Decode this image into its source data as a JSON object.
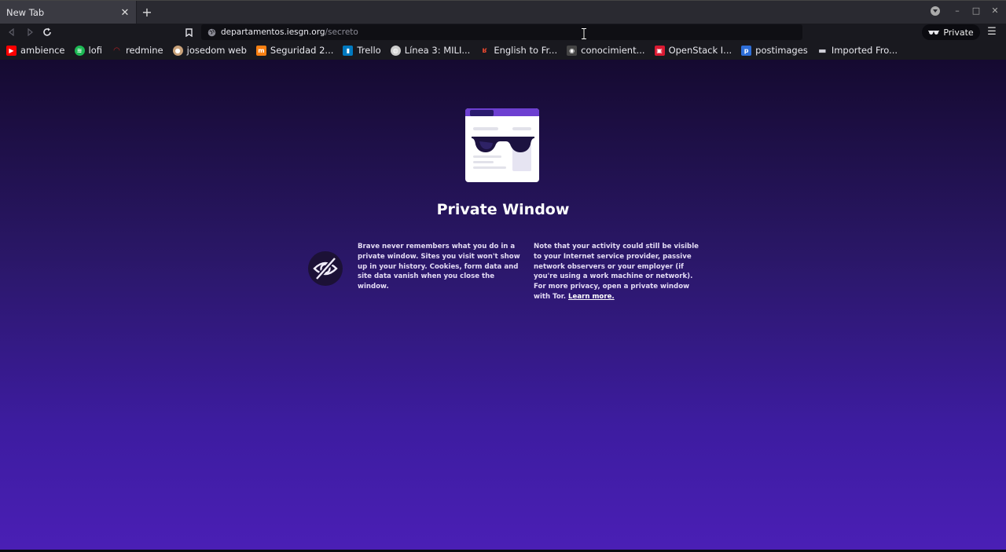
{
  "tab": {
    "title": "New Tab",
    "close_icon": "close-icon",
    "new_tab_label": "+"
  },
  "toolbar": {
    "url_host": "departamentos.iesgn.org",
    "url_path": "/secreto",
    "private_label": "Private"
  },
  "bookmarks": [
    {
      "label": "ambience",
      "icon": "youtube-icon",
      "color": "#ff0000"
    },
    {
      "label": "lofi",
      "icon": "spotify-icon",
      "color": "#1db954"
    },
    {
      "label": "redmine",
      "icon": "redmine-icon",
      "color": "#b32024"
    },
    {
      "label": "josedom web",
      "icon": "avatar-icon",
      "color": "#c9a27a"
    },
    {
      "label": "Seguridad 2...",
      "icon": "moodle-icon",
      "color": "#f98012"
    },
    {
      "label": "Trello",
      "icon": "trello-icon",
      "color": "#0079bf"
    },
    {
      "label": "Línea 3: MILI...",
      "icon": "globe-icon",
      "color": "#cccccc"
    },
    {
      "label": "English to Fr...",
      "icon": "reverso-icon",
      "color": "#e0462e"
    },
    {
      "label": "conocimient...",
      "icon": "owl-icon",
      "color": "#444444"
    },
    {
      "label": "OpenStack I...",
      "icon": "openstack-icon",
      "color": "#da1a32"
    },
    {
      "label": "postimages",
      "icon": "postimages-icon",
      "color": "#2e6ed8"
    },
    {
      "label": "Imported Fro...",
      "icon": "folder-icon",
      "color": "#d0d0d8"
    }
  ],
  "content": {
    "title": "Private Window",
    "left_text": "Brave never remembers what you do in a private window. Sites you visit won't show up in your history. Cookies, form data and site data vanish when you close the window.",
    "right_text": "Note that your activity could still be visible to your Internet service provider, passive network observers or your employer (if you're using a work machine or network). For more privacy, open a private window with Tor.",
    "learn_more": "Learn more."
  }
}
